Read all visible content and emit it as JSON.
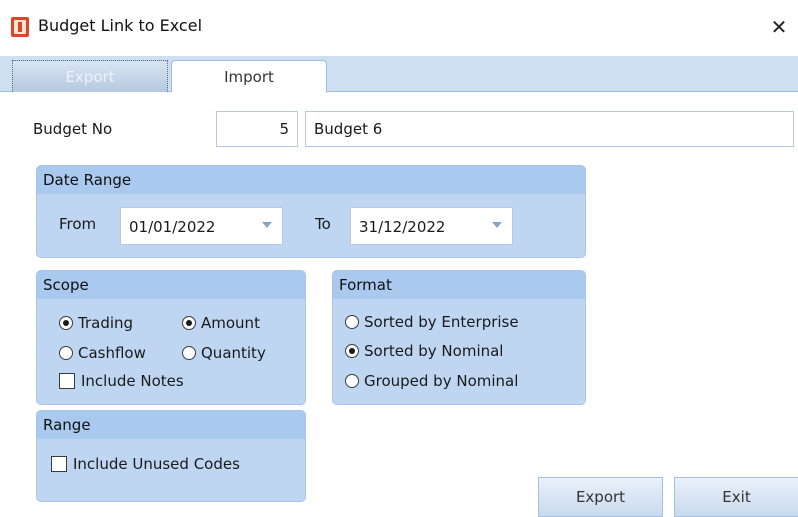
{
  "window": {
    "title": "Budget Link to Excel",
    "close_glyph": "✕"
  },
  "tabs": [
    {
      "label": "Export",
      "active": true
    },
    {
      "label": "Import",
      "active": false
    }
  ],
  "budget": {
    "label": "Budget No",
    "number": "5",
    "name": "Budget 6"
  },
  "date_range": {
    "title": "Date Range",
    "from_label": "From",
    "from_value": "01/01/2022",
    "to_label": "To",
    "to_value": "31/12/2022"
  },
  "scope": {
    "title": "Scope",
    "trading": "Trading",
    "cashflow": "Cashflow",
    "amount": "Amount",
    "quantity": "Quantity",
    "include_notes": "Include Notes",
    "selected_type": "Trading",
    "selected_measure": "Amount"
  },
  "format": {
    "title": "Format",
    "options": [
      "Sorted by Enterprise",
      "Sorted by Nominal",
      "Grouped by Nominal"
    ],
    "selected": "Sorted by Nominal"
  },
  "range": {
    "title": "Range",
    "include_unused": "Include Unused Codes"
  },
  "buttons": {
    "export": "Export",
    "exit": "Exit"
  }
}
